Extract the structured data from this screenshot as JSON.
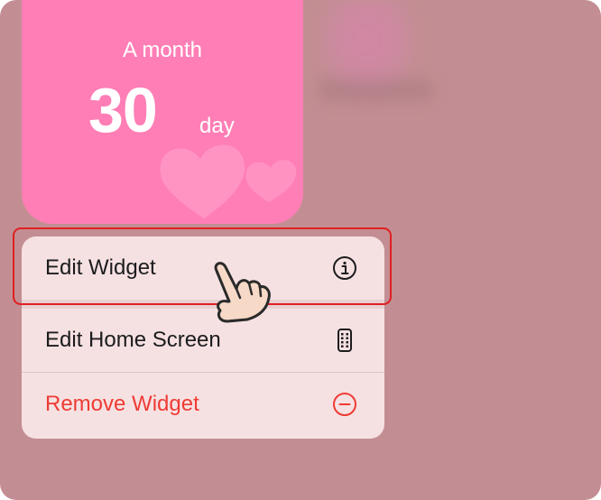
{
  "widget": {
    "caption": "A month",
    "number": "30",
    "unit": "day",
    "color": "#ff7eb5"
  },
  "menu": {
    "items": [
      {
        "label": "Edit Widget",
        "icon": "info-circle-icon"
      },
      {
        "label": "Edit Home Screen",
        "icon": "phone-apps-icon"
      },
      {
        "label": "Remove Widget",
        "icon": "minus-circle-icon",
        "color": "#ee3b34"
      }
    ]
  },
  "annotation": {
    "highlight_color": "#e02020",
    "pointer_icon": "tap-hand-icon"
  }
}
